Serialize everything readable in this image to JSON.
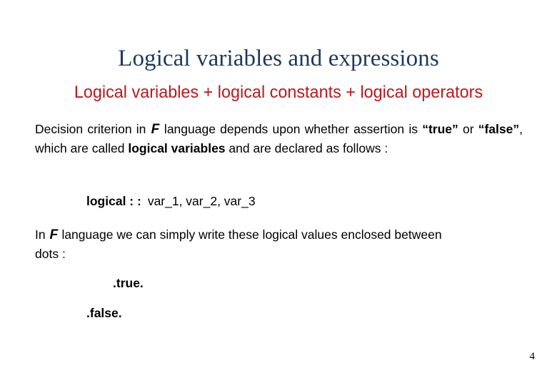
{
  "slide": {
    "title": "Logical variables and expressions",
    "subtitle": "Logical variables + logical constants + logical operators",
    "colors": {
      "title": "#1b3a5c",
      "subtitle": "#c2161b",
      "body": "#000000",
      "background": "#ffffff"
    },
    "paragraph_1": {
      "seg_1": "Decision criterion in ",
      "f_glyph": "F",
      "seg_2": " language depends upon whether assertion is ",
      "true_quoted": "“true”",
      "seg_3": " or ",
      "false_quoted": "“false”",
      "seg_4": ", which are called ",
      "bold_term": "logical variables",
      "seg_5": " and are declared as follows :"
    },
    "declaration": {
      "keyword": "logical : :",
      "variables": "var_1, var_2, var_3"
    },
    "paragraph_2": {
      "seg_1": "In ",
      "f_glyph": "F",
      "seg_2": " language we can simply write these logical values enclosed between dots :"
    },
    "literals": {
      "true": ".true.",
      "false": ".false."
    },
    "page_number": "4"
  }
}
